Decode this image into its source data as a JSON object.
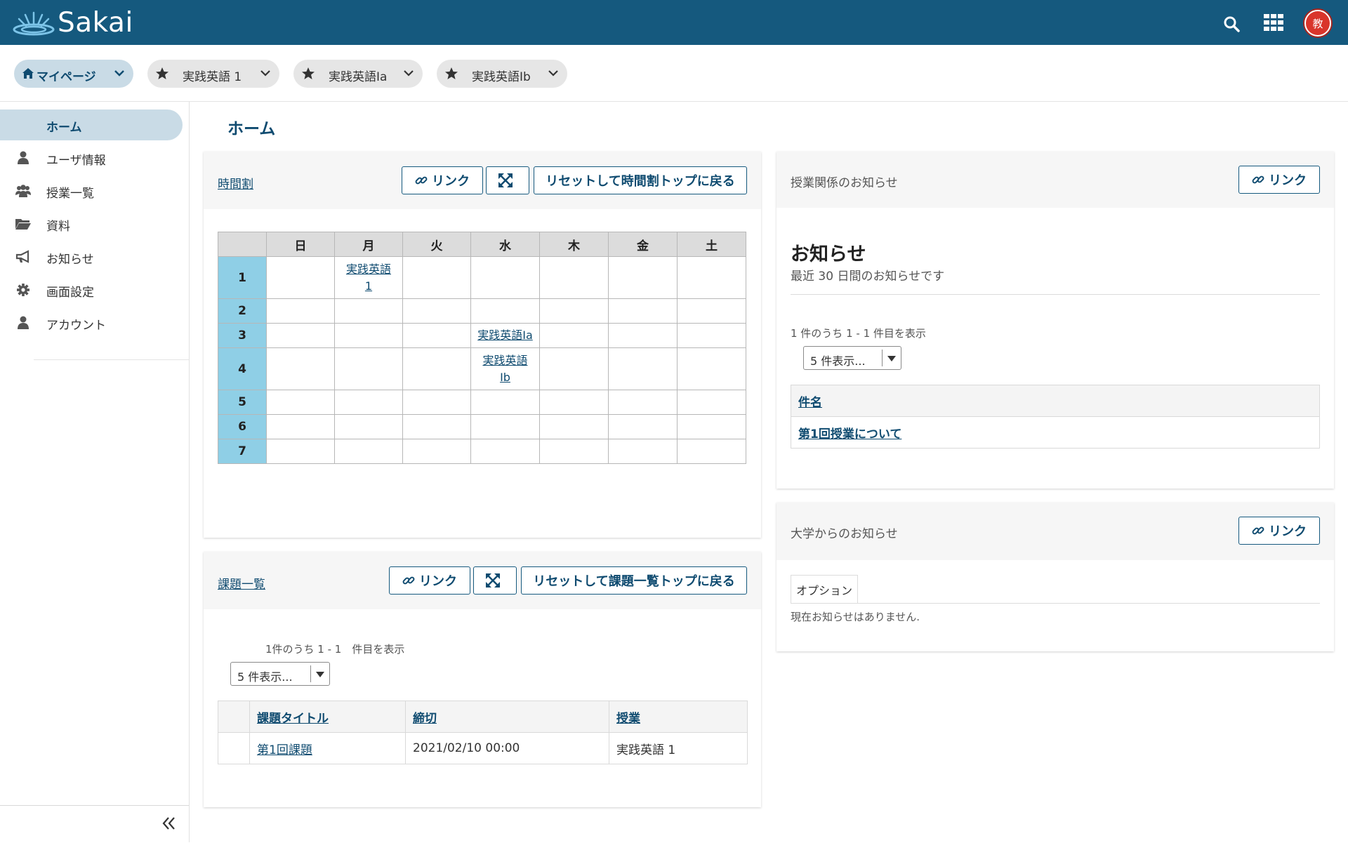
{
  "app": {
    "logo_text": "Sakai",
    "avatar_text": "教",
    "icons": {
      "logo": "sakai-wave-icon",
      "search": "search-icon",
      "apps": "grid-icon"
    }
  },
  "site_tabs": [
    {
      "label": "マイページ",
      "icon": "home-icon"
    },
    {
      "label": "実践英語 1",
      "icon": "star-icon"
    },
    {
      "label": "実践英語Ⅰa",
      "icon": "star-icon"
    },
    {
      "label": "実践英語Ⅰb",
      "icon": "star-icon"
    }
  ],
  "sidebar": {
    "items": [
      {
        "label": "ホーム"
      },
      {
        "label": "ユーザ情報",
        "icon": "user-icon"
      },
      {
        "label": "授業一覧",
        "icon": "users-icon"
      },
      {
        "label": "資料",
        "icon": "folder-icon"
      },
      {
        "label": "お知らせ",
        "icon": "megaphone-icon"
      },
      {
        "label": "画面設定",
        "icon": "gear-icon"
      },
      {
        "label": "アカウント",
        "icon": "user-icon"
      }
    ],
    "collapse_icon": "double-chevron-left-icon"
  },
  "page": {
    "title": "ホーム"
  },
  "timetable": {
    "title": "時間割",
    "link_button": "リンク",
    "reset_button": "リセットして時間割トップに戻る",
    "days": [
      "日",
      "月",
      "火",
      "水",
      "木",
      "金",
      "土"
    ],
    "periods": [
      "1",
      "2",
      "3",
      "4",
      "5",
      "6",
      "7"
    ],
    "cells": {
      "p1_mon_line1": "実践英語",
      "p1_mon_line2": "1",
      "p3_wed": "実践英語Ⅰa",
      "p4_wed_line1": "実践英語",
      "p4_wed_line2": "Ⅰb"
    }
  },
  "assignments": {
    "title": "課題一覧",
    "link_button": "リンク",
    "reset_button": "リセットして課題一覧トップに戻る",
    "count_text": "1件のうち 1 - 1　件目を表示",
    "page_size": "5 件表示...",
    "columns": [
      "課題タイトル",
      "締切",
      "授業"
    ],
    "rows": [
      {
        "title": "第1回課題",
        "due": "2021/02/10 00:00",
        "course": "実践英語 1"
      }
    ]
  },
  "class_news": {
    "title": "授業関係のお知らせ",
    "link_button": "リンク",
    "heading": "お知らせ",
    "subheading": "最近 30 日間のお知らせです",
    "count_text": "1 件のうち 1 - 1 件目を表示",
    "page_size": "5 件表示...",
    "column": "件名",
    "rows": [
      {
        "subject": "第1回授業について"
      }
    ]
  },
  "univ_news": {
    "title": "大学からのお知らせ",
    "link_button": "リンク",
    "options_tab": "オプション",
    "empty_text": "現在お知らせはありません."
  }
}
